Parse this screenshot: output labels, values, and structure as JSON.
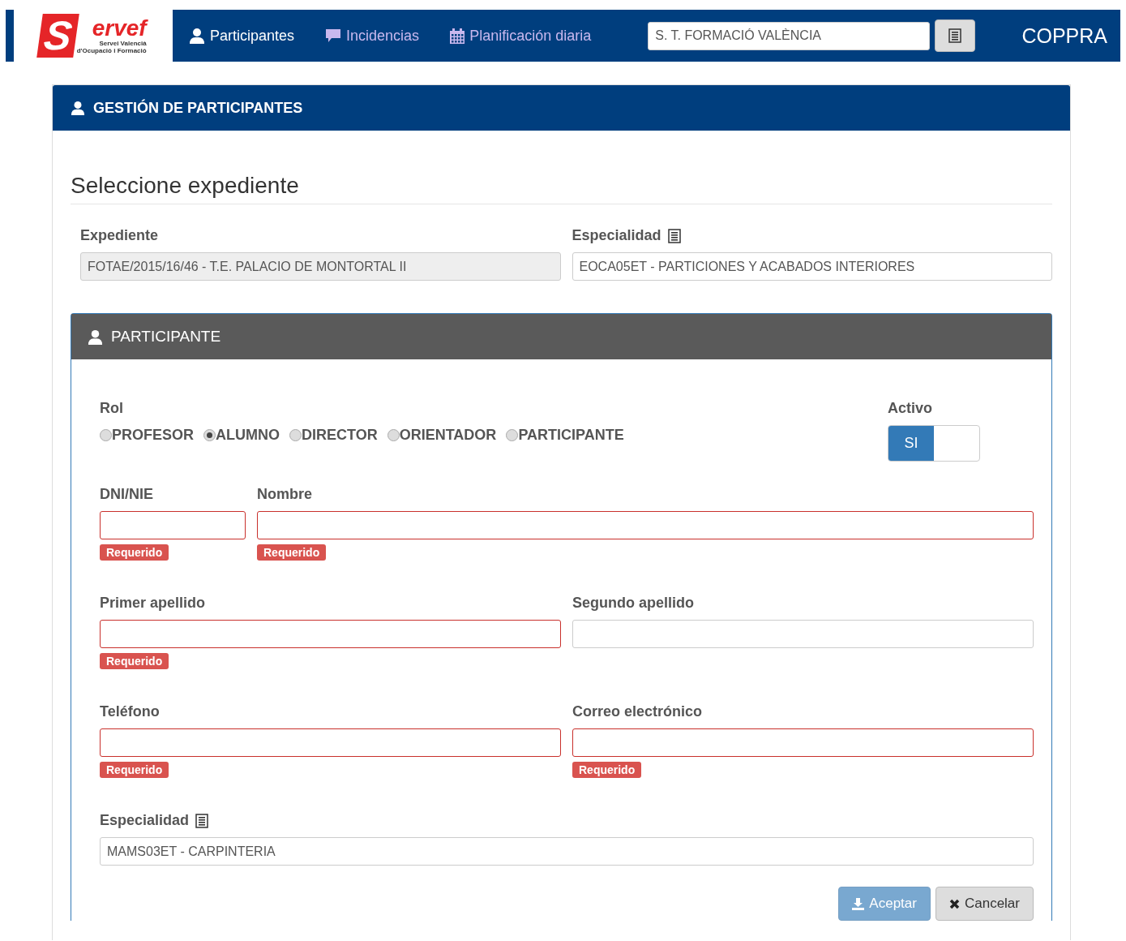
{
  "navbar": {
    "logo": {
      "letter": "S",
      "word": "ervef",
      "tagline_1": "Servei Valencià",
      "tagline_2": "d'Ocupació i Formació"
    },
    "items": [
      {
        "label": "Participantes",
        "selected": true
      },
      {
        "label": "Incidencias",
        "selected": false
      },
      {
        "label": "Planificación diaria",
        "selected": false
      }
    ],
    "center_field": {
      "value": "S. T. FORMACIÓ VALÈNCIA"
    },
    "user": "COPPRA"
  },
  "panel": {
    "title": "GESTIÓN DE PARTICIPANTES",
    "section_title": "Seleccione expediente",
    "expediente": {
      "label": "Expediente",
      "value": "FOTAE/2015/16/46 - T.E. PALACIO DE MONTORTAL II",
      "disabled": true
    },
    "especialidad": {
      "label": "Especialidad",
      "value": "EOCA05ET - PARTICIONES Y ACABADOS INTERIORES",
      "disabled": false
    },
    "participante": {
      "title": "PARTICIPANTE",
      "rol": {
        "label": "Rol",
        "options": [
          {
            "label": "PROFESOR",
            "selected": false
          },
          {
            "label": "ALUMNO",
            "selected": true
          },
          {
            "label": "DIRECTOR",
            "selected": false
          },
          {
            "label": "ORIENTADOR",
            "selected": false
          },
          {
            "label": "PARTICIPANTE",
            "selected": false
          }
        ]
      },
      "activo": {
        "label": "Activo",
        "on_label": "SI",
        "on": true
      },
      "rows": [
        [
          {
            "label": "DNI/NIE",
            "invalid": true,
            "message": "Requerido"
          },
          {
            "label": "Nombre",
            "invalid": true,
            "message": "Requerido"
          }
        ],
        [
          {
            "label": "Primer apellido",
            "invalid": true,
            "message": "Requerido"
          },
          {
            "label": "Segundo apellido",
            "invalid": false
          }
        ],
        [
          {
            "label": "Teléfono",
            "invalid": true,
            "message": "Requerido"
          },
          {
            "label": "Correo electrónico",
            "invalid": true,
            "message": "Requerido"
          }
        ]
      ],
      "especialidad": {
        "label": "Especialidad",
        "value": "MAMS03ET - CARPINTERIA"
      },
      "buttons": [
        {
          "label": "Aceptar",
          "kind": "primary",
          "disabled": true
        },
        {
          "label": "Cancelar",
          "kind": "default",
          "disabled": false
        }
      ]
    }
  }
}
